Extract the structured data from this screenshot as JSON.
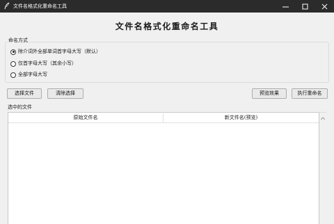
{
  "window": {
    "title": "文件名格式化重命名工具",
    "controls": [
      "minimize-icon",
      "maximize-icon",
      "close-icon"
    ]
  },
  "header": {
    "title": "文件名格式化重命名工具"
  },
  "naming": {
    "group_label": "命名方式",
    "options": [
      {
        "label": "除介词外全部单词首字母大写（默认）",
        "selected": true
      },
      {
        "label": "仅首字母大写（其余小写）",
        "selected": false
      },
      {
        "label": "全部字母大写",
        "selected": false
      }
    ]
  },
  "toolbar": {
    "select_files": "选择文件",
    "clear_selection": "清除选择",
    "preview": "预览效果",
    "execute": "执行重命名"
  },
  "files": {
    "label": "选中的文件",
    "columns": [
      "原始文件名",
      "新文件名(预览)"
    ],
    "rows": []
  }
}
